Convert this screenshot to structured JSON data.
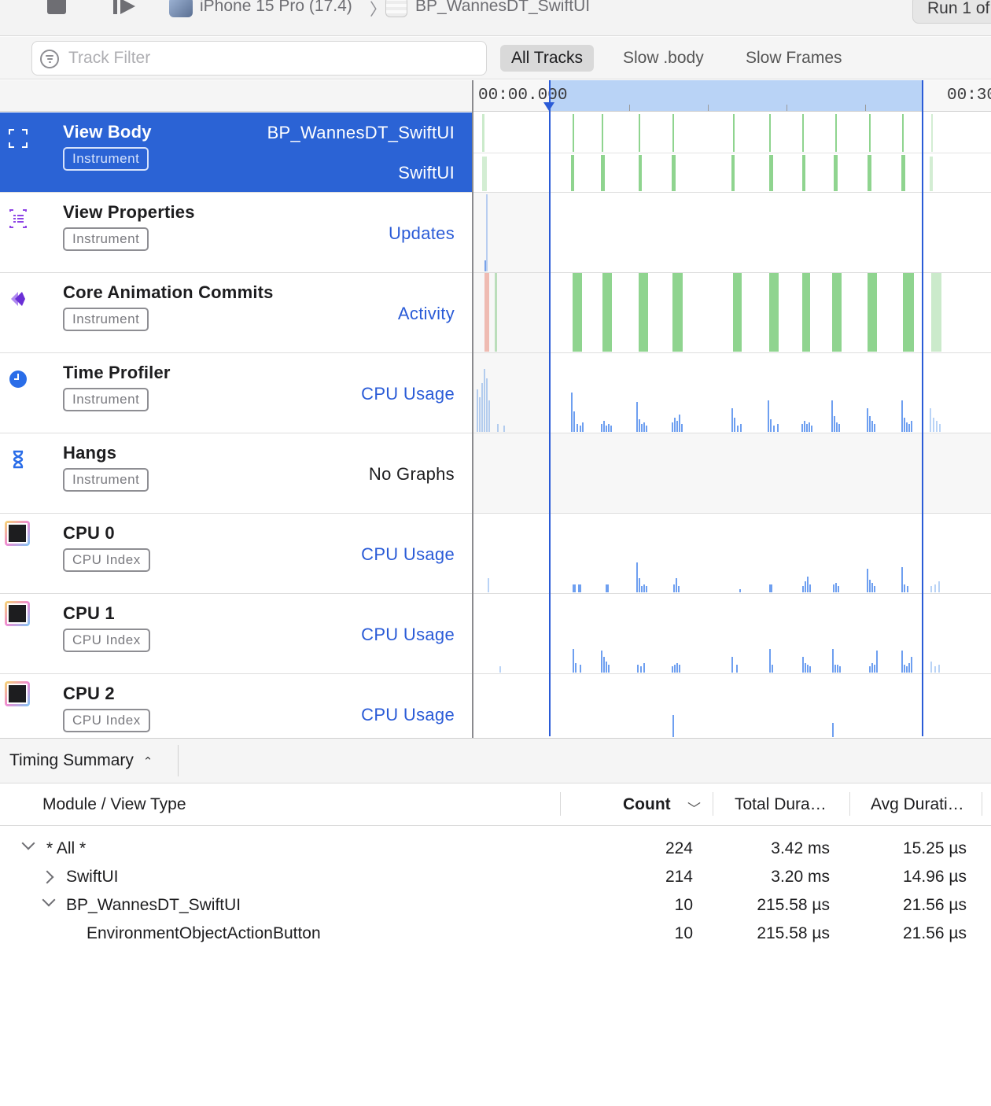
{
  "toolbar": {
    "device": "iPhone 15 Pro (17.4)",
    "target": "BP_WannesDT_SwiftUI",
    "run_label": "Run 1 of"
  },
  "filter": {
    "placeholder": "Track Filter",
    "segments": [
      "All Tracks",
      "Slow .body",
      "Slow Frames"
    ],
    "active_segment": "All Tracks"
  },
  "ruler": {
    "start_time": "00:00.000",
    "end_time": "00:30"
  },
  "tracks": [
    {
      "name": "View Body",
      "badge": "Instrument",
      "right": "BP_WannesDT_SwiftUI",
      "right2": "SwiftUI",
      "icon": "view-body-icon",
      "selected": true
    },
    {
      "name": "View Properties",
      "badge": "Instrument",
      "right": "Updates",
      "icon": "view-properties-icon"
    },
    {
      "name": "Core Animation Commits",
      "badge": "Instrument",
      "right": "Activity",
      "icon": "core-animation-icon"
    },
    {
      "name": "Time Profiler",
      "badge": "Instrument",
      "right": "CPU Usage",
      "icon": "time-profiler-icon"
    },
    {
      "name": "Hangs",
      "badge": "Instrument",
      "right": "No Graphs",
      "icon": "hourglass-icon"
    },
    {
      "name": "CPU 0",
      "badge": "CPU Index",
      "right": "CPU Usage",
      "icon": "cpu-icon"
    },
    {
      "name": "CPU 1",
      "badge": "CPU Index",
      "right": "CPU Usage",
      "icon": "cpu-icon"
    },
    {
      "name": "CPU 2",
      "badge": "CPU Index",
      "right": "CPU Usage",
      "icon": "cpu-icon"
    }
  ],
  "summary": {
    "selector": "Timing Summary",
    "columns": [
      "Module / View Type",
      "Count",
      "Total Dura…",
      "Avg Durati…"
    ],
    "rows": [
      {
        "name": "* All *",
        "count": "224",
        "total": "3.42 ms",
        "avg": "15.25 µs"
      },
      {
        "name": "SwiftUI",
        "count": "214",
        "total": "3.20 ms",
        "avg": "14.96 µs"
      },
      {
        "name": "BP_WannesDT_SwiftUI",
        "count": "10",
        "total": "215.58 µs",
        "avg": "21.56 µs"
      },
      {
        "name": "EnvironmentObjectActionButton",
        "count": "10",
        "total": "215.58 µs",
        "avg": "21.56 µs"
      }
    ]
  },
  "colors": {
    "accent": "#2b63d5",
    "green_bar": "#8fd48f",
    "blue_bar": "#6e9ff0",
    "light_blue": "#b9d3f6"
  }
}
